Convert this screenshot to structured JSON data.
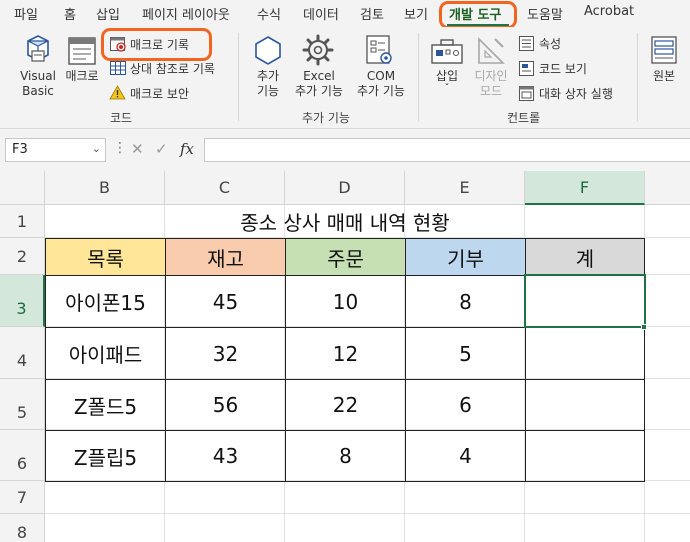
{
  "menu": {
    "items": [
      "파일",
      "홈",
      "삽입",
      "페이지 레이아웃",
      "수식",
      "데이터",
      "검토",
      "보기",
      "개발 도구",
      "도움말",
      "Acrobat"
    ],
    "active": "개발 도구"
  },
  "ribbon": {
    "code_group": {
      "visual_basic_line1": "Visual",
      "visual_basic_line2": "Basic",
      "macro": "매크로",
      "record_macro": "매크로 기록",
      "relative_ref": "상대 참조로 기록",
      "macro_security": "매크로 보안",
      "group_name": "코드"
    },
    "addins_group": {
      "addins_line1": "추가",
      "addins_line2": "기능",
      "excel_addins_line1": "Excel",
      "excel_addins_line2": "추가 기능",
      "com_addins_line1": "COM",
      "com_addins_line2": "추가 기능",
      "group_name": "추가 기능"
    },
    "controls_group": {
      "insert": "삽입",
      "design_mode_line1": "디자인",
      "design_mode_line2": "모드",
      "properties": "속성",
      "view_code": "코드 보기",
      "run_dialog": "대화 상자 실행",
      "group_name": "컨트롤"
    },
    "source": "원본"
  },
  "formula_bar": {
    "name_box": "F3",
    "fx": "fx",
    "value": ""
  },
  "grid": {
    "columns": [
      "B",
      "C",
      "D",
      "E",
      "F"
    ],
    "rows": [
      "1",
      "2",
      "3",
      "4",
      "5",
      "6",
      "7",
      "8"
    ],
    "selected_cell": "F3"
  },
  "sheet": {
    "title": "종소 상사 매매 내역 현황",
    "headers": [
      "목록",
      "재고",
      "주문",
      "기부",
      "계"
    ],
    "header_colors": [
      "#ffe699",
      "#f8cbad",
      "#c6e0b4",
      "#bdd7ee",
      "#d9d9d9"
    ],
    "rows": [
      [
        "아이폰15",
        "45",
        "10",
        "8",
        ""
      ],
      [
        "아이패드",
        "32",
        "12",
        "5",
        ""
      ],
      [
        "Z폴드5",
        "56",
        "22",
        "6",
        ""
      ],
      [
        "Z플립5",
        "43",
        "8",
        "4",
        ""
      ]
    ]
  },
  "colors": {
    "accent": "#217346",
    "highlight": "#f2651f"
  }
}
